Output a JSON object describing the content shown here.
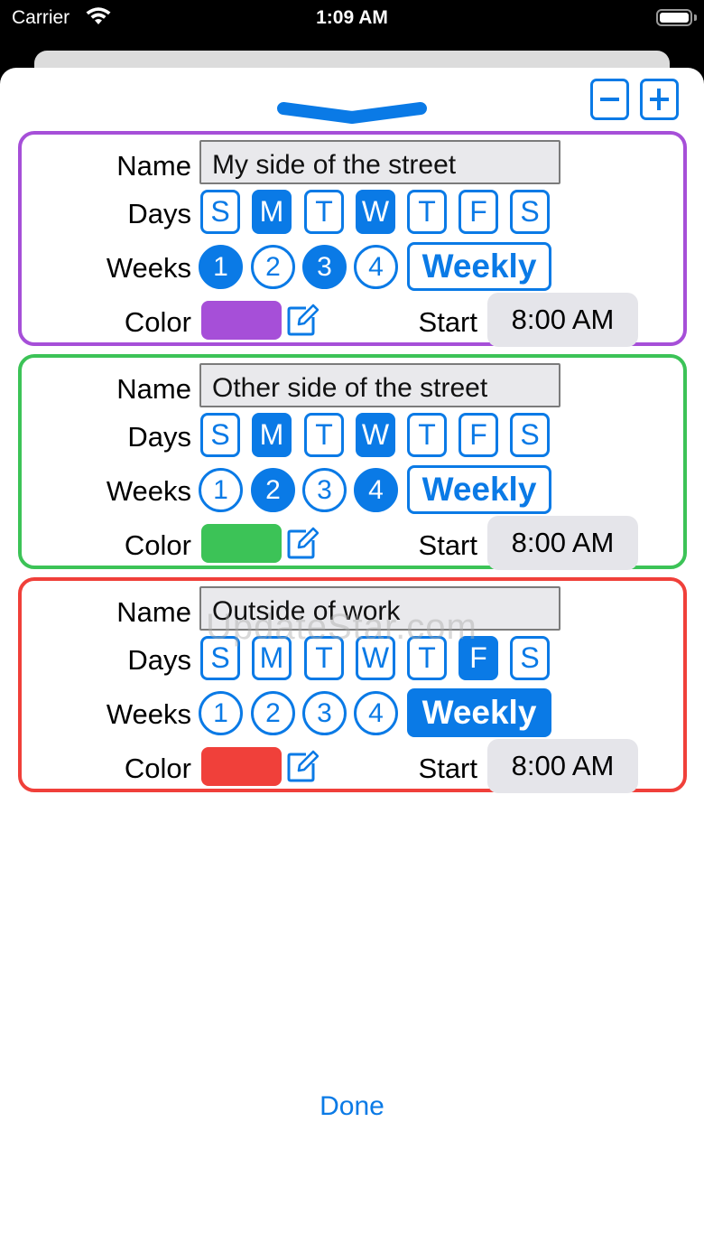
{
  "status_bar": {
    "carrier": "Carrier",
    "time": "1:09 AM"
  },
  "toolbar": {
    "minus_icon": "minus-icon",
    "plus_icon": "plus-icon"
  },
  "labels": {
    "name": "Name",
    "days": "Days",
    "weeks": "Weeks",
    "color": "Color",
    "start": "Start"
  },
  "schedules": [
    {
      "name": "My side of the street",
      "border_color": "#a64fd8",
      "color": "#a64fd8",
      "days": [
        {
          "label": "S",
          "selected": false
        },
        {
          "label": "M",
          "selected": true
        },
        {
          "label": "T",
          "selected": false
        },
        {
          "label": "W",
          "selected": true
        },
        {
          "label": "T",
          "selected": false
        },
        {
          "label": "F",
          "selected": false
        },
        {
          "label": "S",
          "selected": false
        }
      ],
      "weeks": [
        {
          "label": "1",
          "selected": true
        },
        {
          "label": "2",
          "selected": false
        },
        {
          "label": "3",
          "selected": true
        },
        {
          "label": "4",
          "selected": false
        }
      ],
      "weekly": {
        "label": "Weekly",
        "selected": false
      },
      "start": "8:00 AM"
    },
    {
      "name": "Other side of the street",
      "border_color": "#3cc357",
      "color": "#3cc357",
      "days": [
        {
          "label": "S",
          "selected": false
        },
        {
          "label": "M",
          "selected": true
        },
        {
          "label": "T",
          "selected": false
        },
        {
          "label": "W",
          "selected": true
        },
        {
          "label": "T",
          "selected": false
        },
        {
          "label": "F",
          "selected": false
        },
        {
          "label": "S",
          "selected": false
        }
      ],
      "weeks": [
        {
          "label": "1",
          "selected": false
        },
        {
          "label": "2",
          "selected": true
        },
        {
          "label": "3",
          "selected": false
        },
        {
          "label": "4",
          "selected": true
        }
      ],
      "weekly": {
        "label": "Weekly",
        "selected": false
      },
      "start": "8:00 AM"
    },
    {
      "name": "Outside of work",
      "border_color": "#f0403a",
      "color": "#f0403a",
      "days": [
        {
          "label": "S",
          "selected": false
        },
        {
          "label": "M",
          "selected": false
        },
        {
          "label": "T",
          "selected": false
        },
        {
          "label": "W",
          "selected": false
        },
        {
          "label": "T",
          "selected": false
        },
        {
          "label": "F",
          "selected": true
        },
        {
          "label": "S",
          "selected": false
        }
      ],
      "weeks": [
        {
          "label": "1",
          "selected": false
        },
        {
          "label": "2",
          "selected": false
        },
        {
          "label": "3",
          "selected": false
        },
        {
          "label": "4",
          "selected": false
        }
      ],
      "weekly": {
        "label": "Weekly",
        "selected": true
      },
      "start": "8:00 AM"
    }
  ],
  "watermark": "UpdateStar.com",
  "done_label": "Done",
  "colors": {
    "accent": "#0a7ae6"
  }
}
